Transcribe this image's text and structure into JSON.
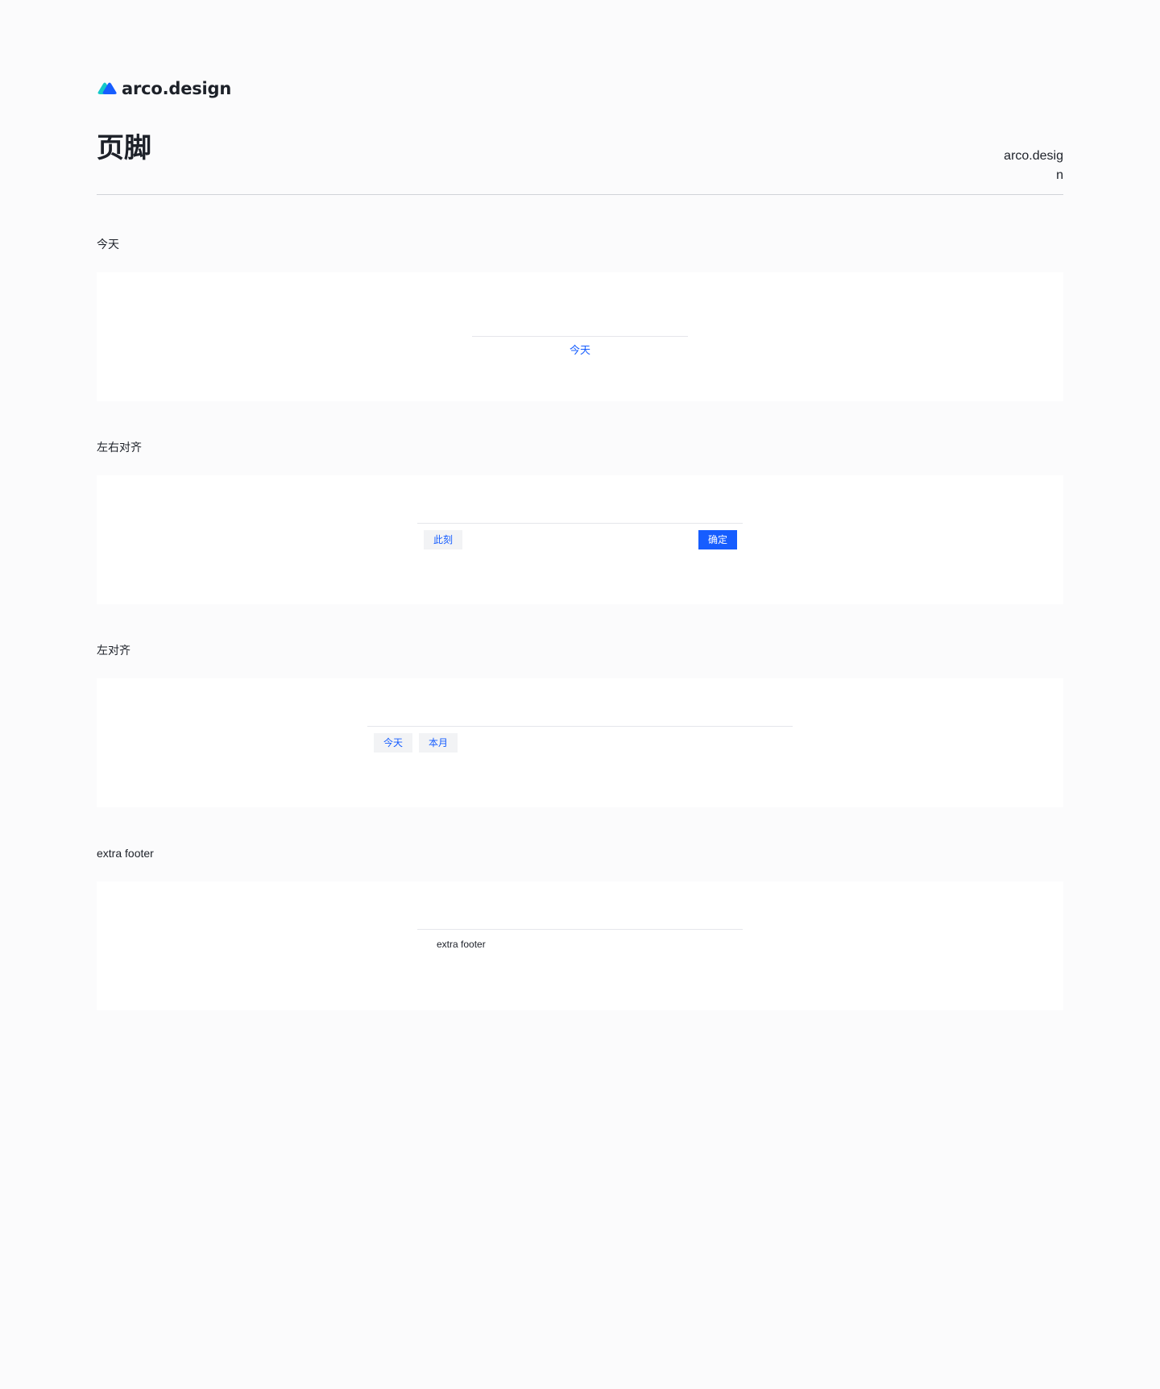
{
  "brand": {
    "name": "arco.design",
    "colors": {
      "primary": "#165dff",
      "accent": "#14c9c9"
    }
  },
  "header": {
    "title": "页脚",
    "right_text": "arco.design"
  },
  "sections": [
    {
      "title": "今天",
      "demo": {
        "today_link": "今天"
      }
    },
    {
      "title": "左右对齐",
      "demo": {
        "now_button": "此刻",
        "confirm_button": "确定"
      }
    },
    {
      "title": "左对齐",
      "demo": {
        "today_button": "今天",
        "month_button": "本月"
      }
    },
    {
      "title": "extra footer",
      "demo": {
        "extra_text": "extra footer"
      }
    }
  ]
}
